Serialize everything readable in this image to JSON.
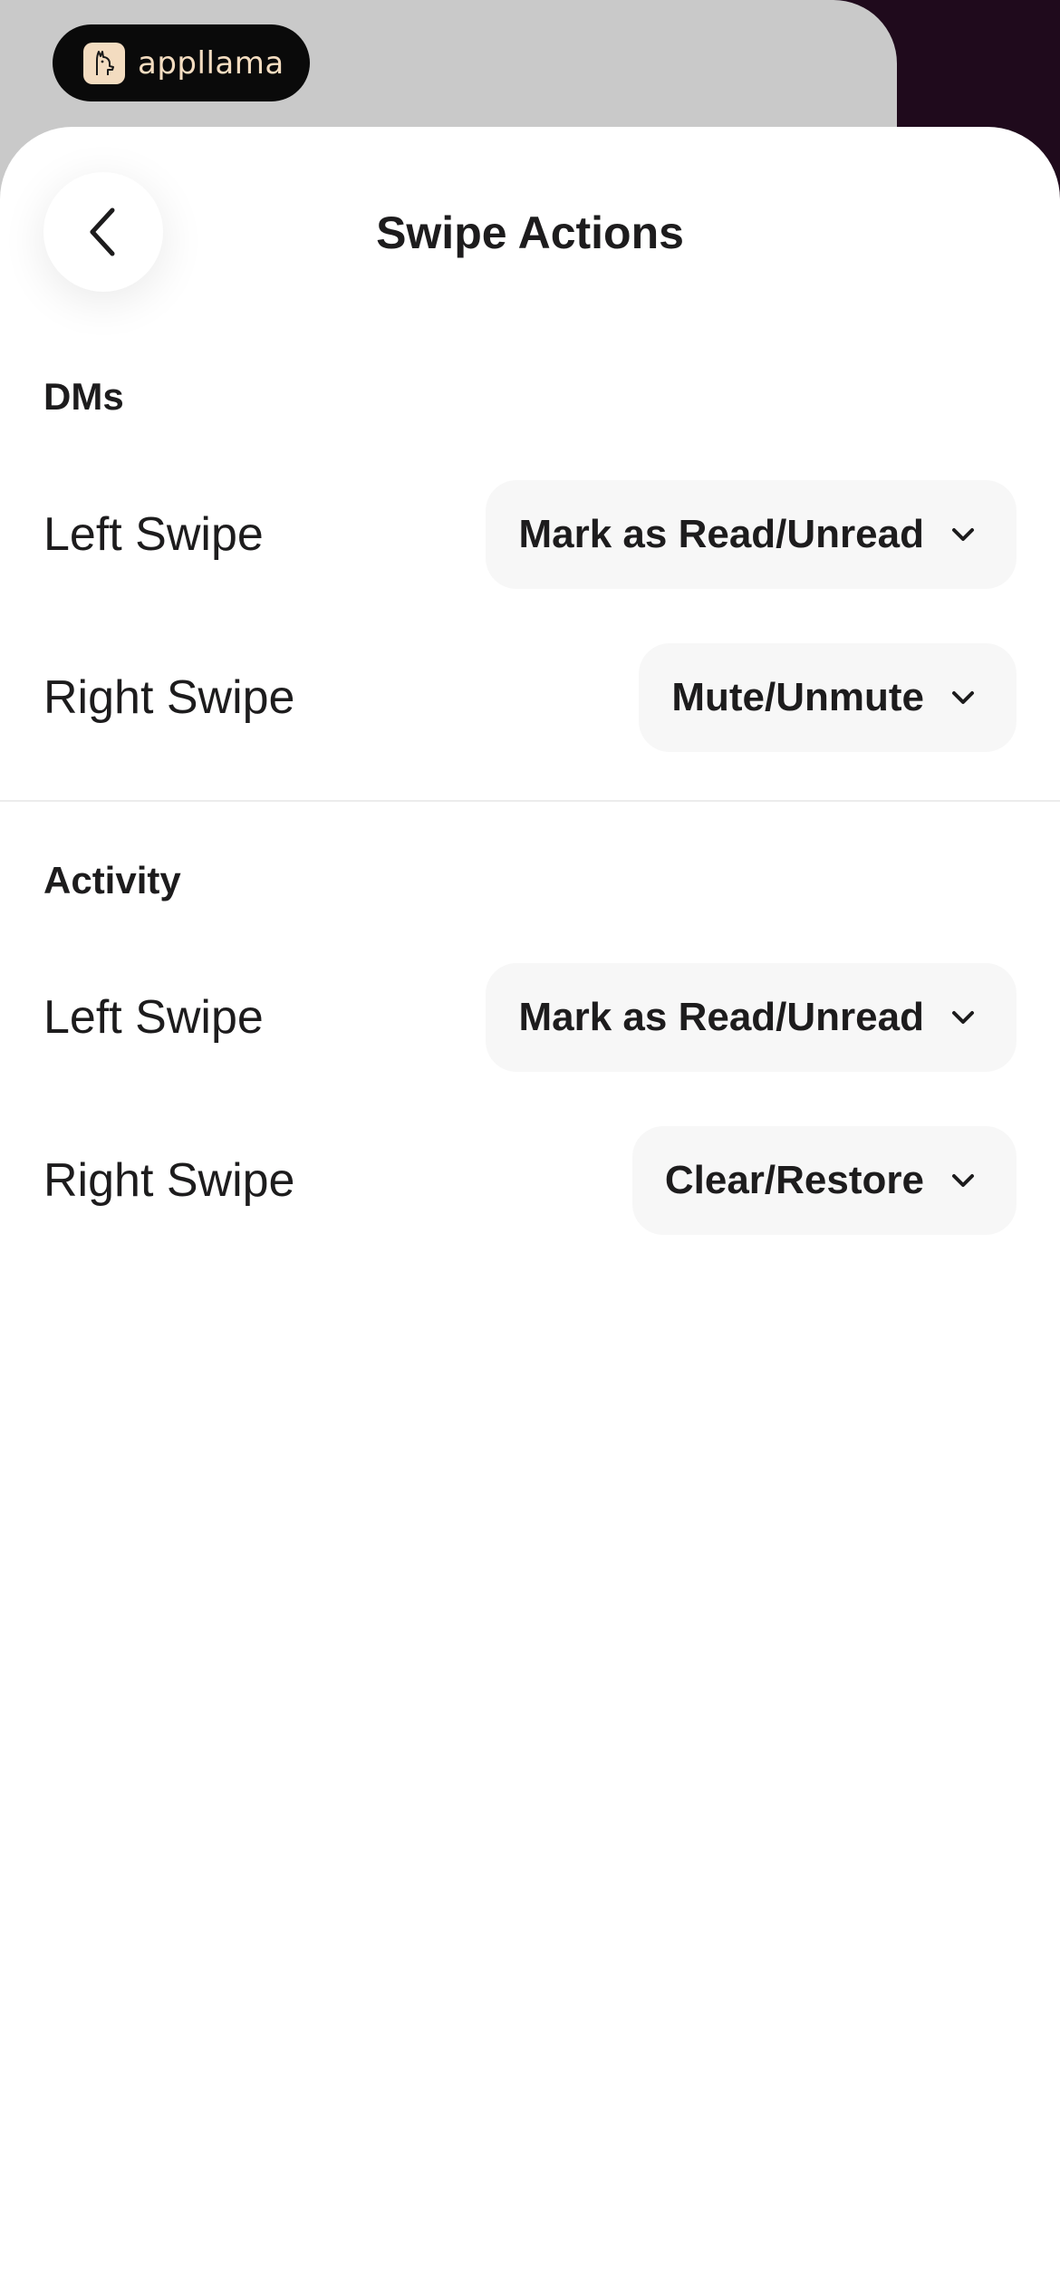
{
  "brand": {
    "name": "appllama"
  },
  "header": {
    "title": "Swipe Actions"
  },
  "sections": [
    {
      "title": "DMs",
      "rows": [
        {
          "label": "Left Swipe",
          "value": "Mark as Read/Unread"
        },
        {
          "label": "Right Swipe",
          "value": "Mute/Unmute"
        }
      ]
    },
    {
      "title": "Activity",
      "rows": [
        {
          "label": "Left Swipe",
          "value": "Mark as Read/Unread"
        },
        {
          "label": "Right Swipe",
          "value": "Clear/Restore"
        }
      ]
    }
  ],
  "colors": {
    "text": "#1d1c1d",
    "dropdown_bg": "#f7f7f7",
    "brand_pill": "#0a0a0a",
    "brand_accent": "#f3dcc0",
    "bg_gray": "#c9c9c9",
    "bg_dark": "#1f0a1c"
  },
  "icons": {
    "back": "chevron-left-icon",
    "dropdown": "chevron-down-icon",
    "brand": "llama-logo-icon"
  }
}
